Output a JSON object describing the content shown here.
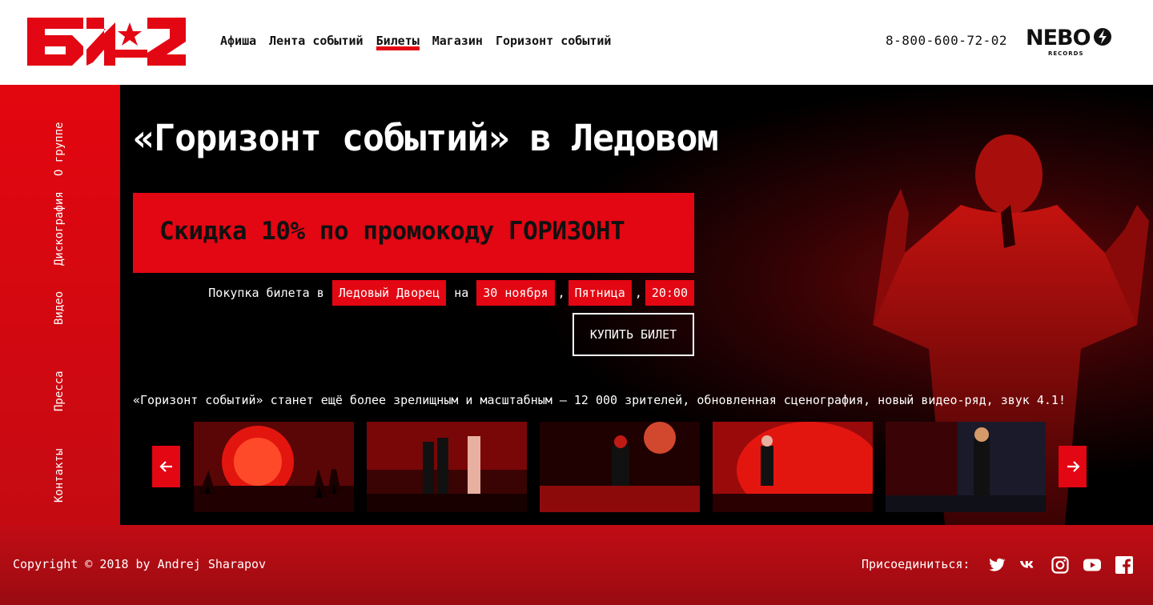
{
  "header": {
    "logo_text": "БИ-2",
    "nav": [
      {
        "label": "Афиша",
        "active": false
      },
      {
        "label": "Лента событий",
        "active": false
      },
      {
        "label": "Билеты",
        "active": true
      },
      {
        "label": "Магазин",
        "active": false
      },
      {
        "label": "Горизонт событий",
        "active": false
      }
    ],
    "phone": "8-800-600-72-02",
    "partner_logo": {
      "text": "NEBO",
      "subtext": "RECORDS"
    }
  },
  "sidebar": {
    "items": [
      "О группе",
      "Дискография",
      "Видео",
      "Пресса",
      "Контакты"
    ]
  },
  "main": {
    "title": "«Горизонт событий» в Ледовом",
    "promo": "Скидка 10% по промокоду ГОРИЗОНТ",
    "purchase": {
      "prefix": "Покупка билета в",
      "venue": "Ледовый Дворец",
      "on": "на",
      "date": "30 ноября",
      "comma": ",",
      "weekday": "Пятница",
      "time": "20:00"
    },
    "buy_button": "КУПИТЬ БИЛЕТ",
    "description": "«Горизонт событий» станет ещё более зрелищным и масштабным — 12 000 зрителей, обновленная сценография, новый видео-ряд, звук 4.1!",
    "gallery": {
      "prev_icon": "arrow-left-icon",
      "next_icon": "arrow-right-icon",
      "photos": [
        "concert-photo-1",
        "concert-photo-2",
        "concert-photo-3",
        "concert-photo-4",
        "concert-photo-5"
      ]
    }
  },
  "footer": {
    "copyright": "Copyright © 2018 by Andrej Sharapov",
    "join_label": "Присоединиться:",
    "social": [
      "twitter-icon",
      "vk-icon",
      "instagram-icon",
      "youtube-icon",
      "facebook-icon"
    ]
  },
  "colors": {
    "accent": "#e30613",
    "footer": "#b10c12",
    "hero_bg": "#000000"
  }
}
